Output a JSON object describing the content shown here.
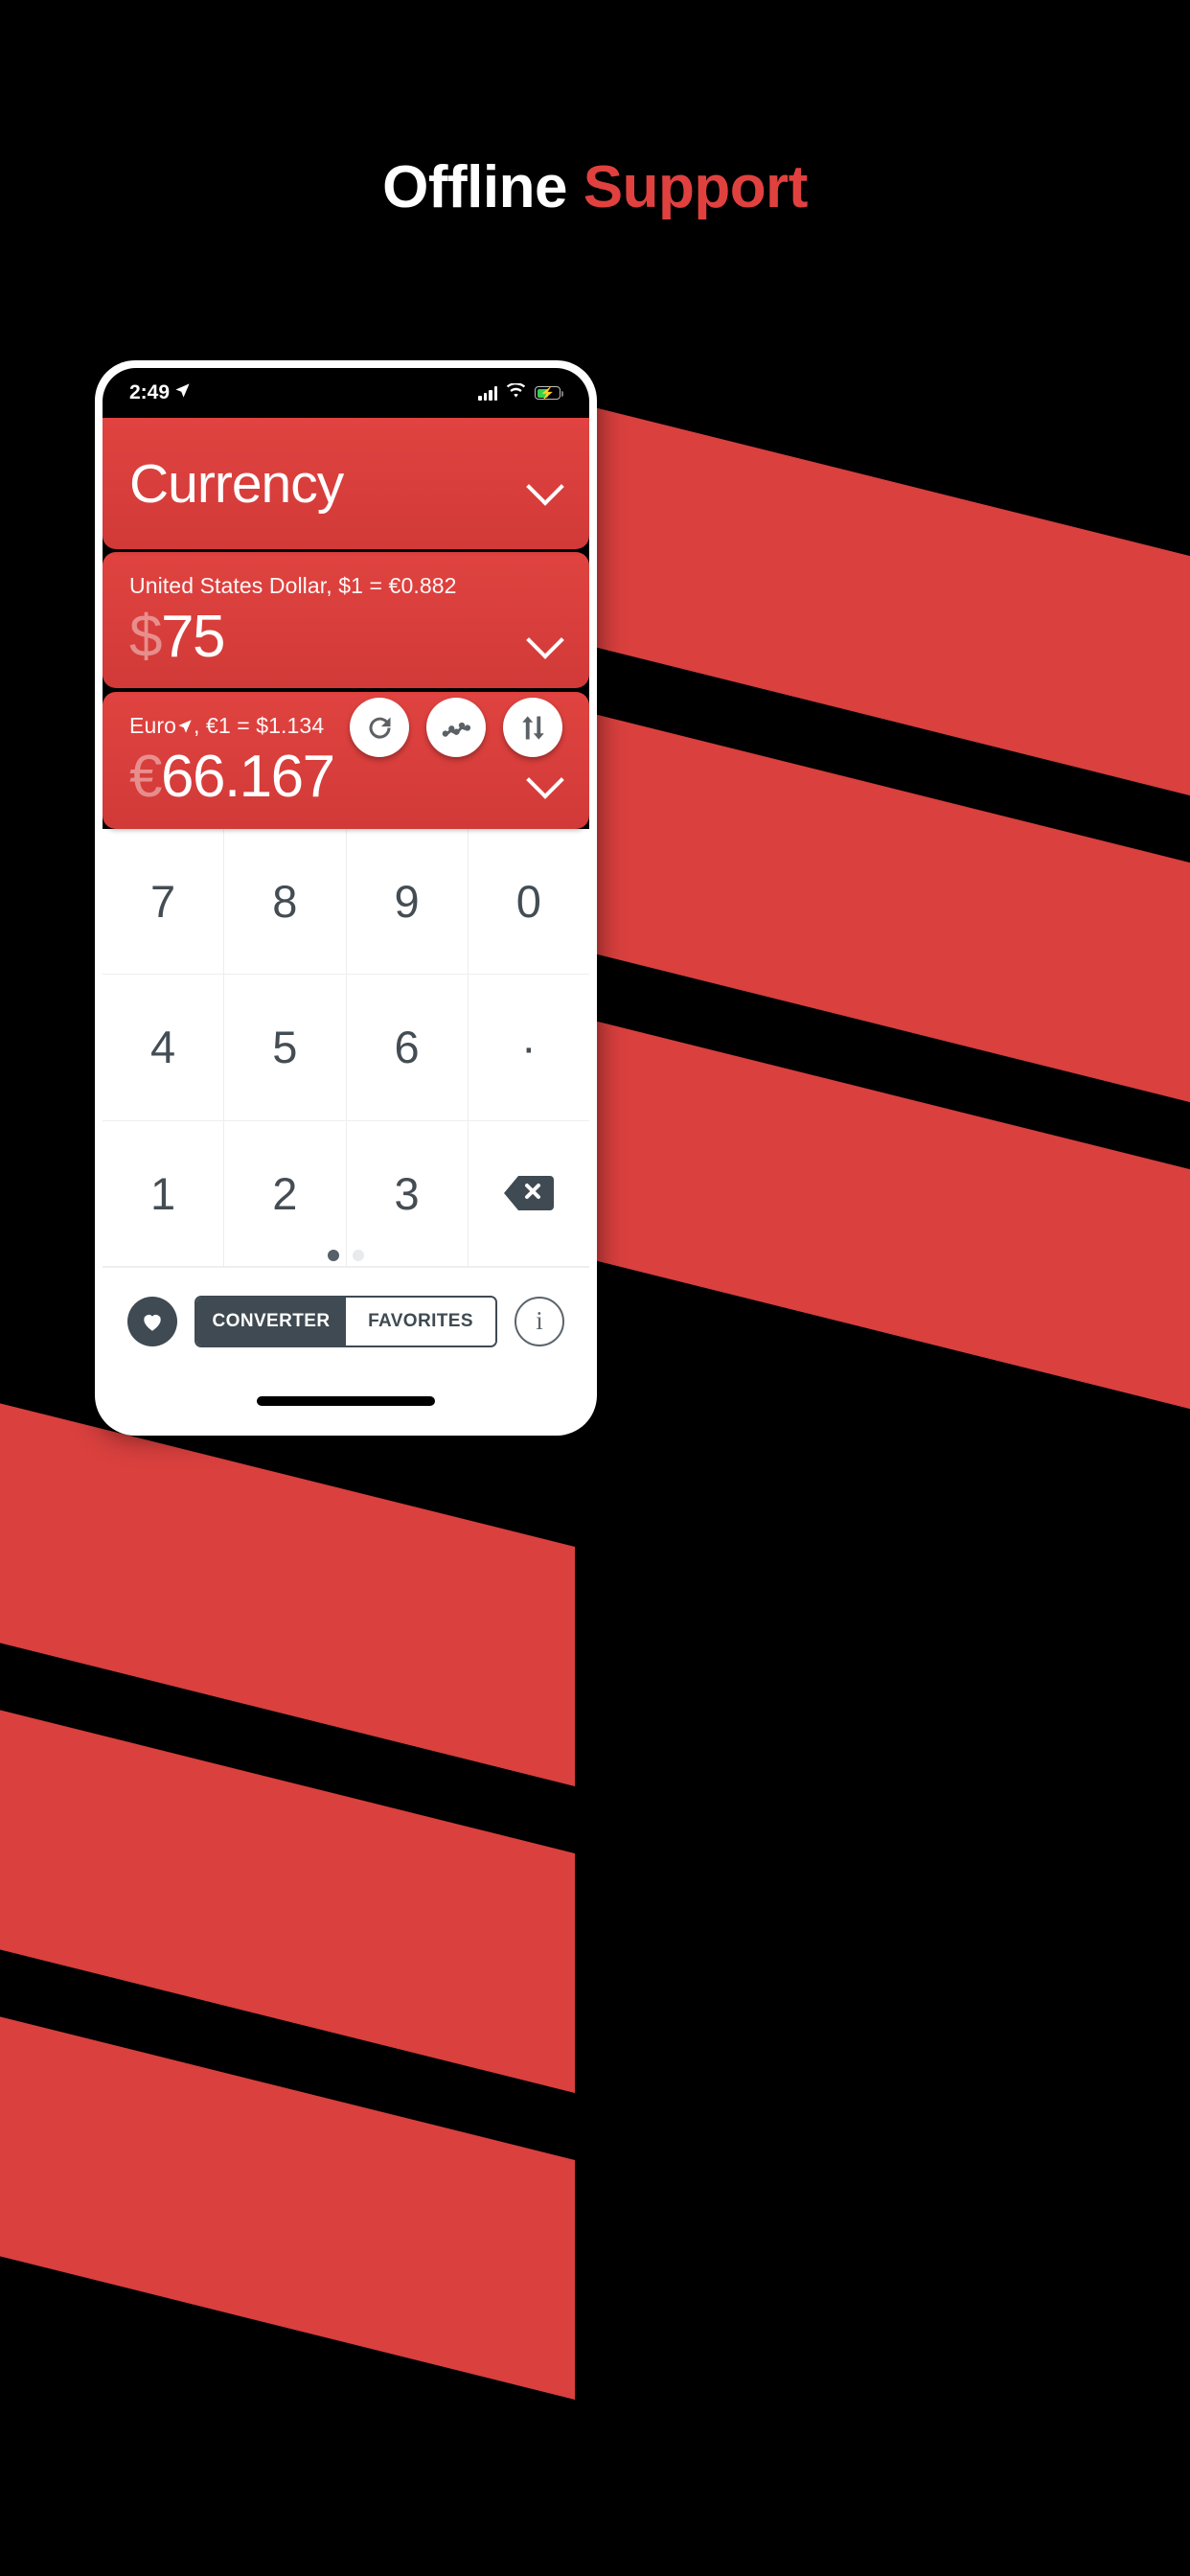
{
  "headline": {
    "white": "Offline ",
    "red": "Support"
  },
  "status_bar": {
    "time": "2:49",
    "location_icon": "location-arrow-icon",
    "signal_icon": "cellular-signal-icon",
    "wifi_icon": "wifi-icon",
    "battery_icon": "battery-charging-icon"
  },
  "app": {
    "title": "Currency",
    "from": {
      "rate_text": "United States Dollar, $1 = €0.882",
      "symbol": "$",
      "amount": "75"
    },
    "to": {
      "name": "Euro",
      "location_icon": "location-arrow-icon",
      "rate_text": ", €1 = $1.134",
      "symbol": "€",
      "amount": "66.167"
    },
    "actions": [
      {
        "name": "refresh-button",
        "icon": "refresh-icon"
      },
      {
        "name": "chart-button",
        "icon": "line-chart-icon"
      },
      {
        "name": "swap-button",
        "icon": "swap-vertical-icon"
      }
    ],
    "keypad": [
      [
        "7",
        "8",
        "9",
        "0"
      ],
      [
        "4",
        "5",
        "6",
        "·"
      ],
      [
        "1",
        "2",
        "3",
        "backspace-icon"
      ]
    ],
    "page_dots": {
      "count": 2,
      "active_index": 0
    },
    "bottom": {
      "favorites_icon": "heart-icon",
      "tab_converter": "CONVERTER",
      "tab_favorites": "FAVORITES",
      "active_tab": "CONVERTER",
      "info_label": "i"
    }
  },
  "colors": {
    "brand_red": "#d9403e",
    "panel_red": "#e04340",
    "dark_slate": "#3f4a52",
    "battery_green": "#35d14b",
    "background": "#000000"
  }
}
